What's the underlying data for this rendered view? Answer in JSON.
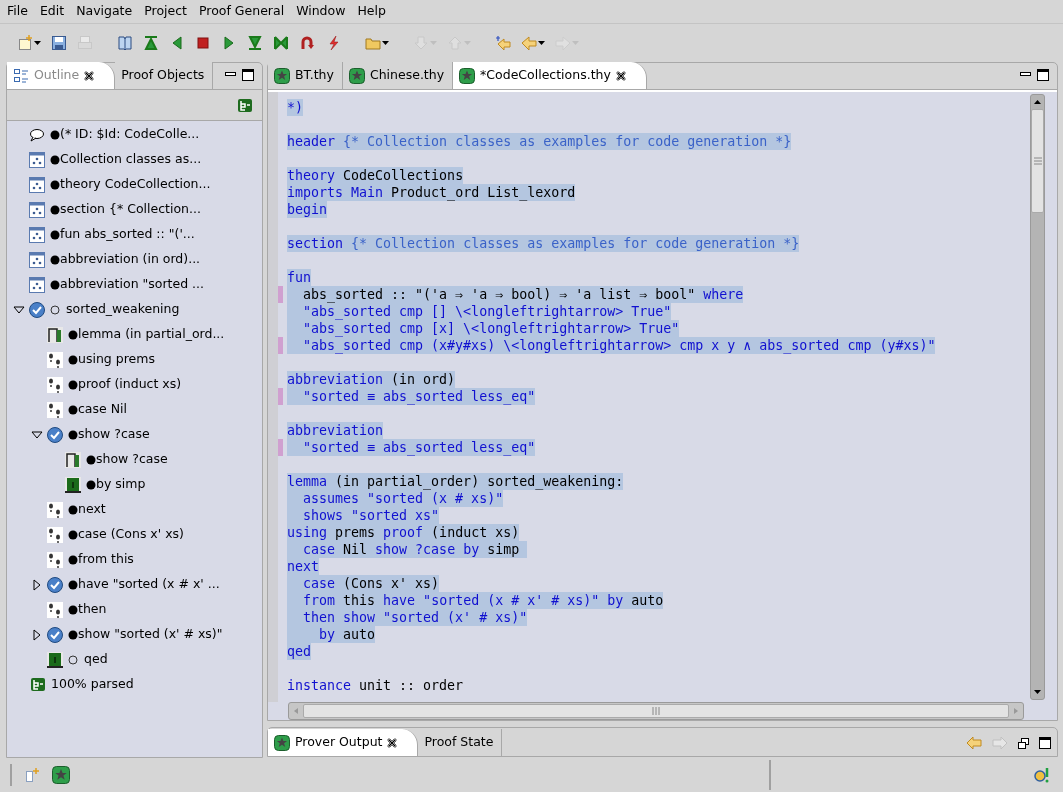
{
  "menu": [
    {
      "label": "File"
    },
    {
      "label": "Edit"
    },
    {
      "label": "Navigate"
    },
    {
      "label": "Project"
    },
    {
      "label": "Proof General"
    },
    {
      "label": "Window"
    },
    {
      "label": "Help"
    }
  ],
  "toolbar": [
    {
      "kind": "new",
      "disabled": false,
      "dropdown": true
    },
    {
      "kind": "save",
      "disabled": false
    },
    {
      "kind": "print",
      "disabled": true
    },
    {
      "kind": "book",
      "disabled": false
    },
    {
      "kind": "first",
      "disabled": false
    },
    {
      "kind": "back",
      "disabled": false
    },
    {
      "kind": "stop",
      "disabled": false
    },
    {
      "kind": "play",
      "disabled": false
    },
    {
      "kind": "last",
      "disabled": false
    },
    {
      "kind": "bowtie",
      "disabled": false
    },
    {
      "kind": "undo",
      "disabled": false
    },
    {
      "kind": "bolt",
      "disabled": false
    },
    {
      "kind": "folder",
      "disabled": false,
      "dropdown": true
    },
    {
      "kind": "down",
      "disabled": true,
      "dropdown": true
    },
    {
      "kind": "up",
      "disabled": true,
      "dropdown": true
    },
    {
      "kind": "starback",
      "disabled": false
    },
    {
      "kind": "left",
      "disabled": false,
      "dropdown": true
    },
    {
      "kind": "right",
      "disabled": true,
      "dropdown": true
    }
  ],
  "left_panel": {
    "tabs": [
      {
        "label": "Outline",
        "selected": true
      },
      {
        "label": "Proof Objects",
        "selected": false
      }
    ],
    "outline": [
      {
        "kind": "comment",
        "complete": true,
        "label": "(* ID: $Id: CodeColle..."
      },
      {
        "kind": "section",
        "complete": true,
        "label": "Collection classes as..."
      },
      {
        "kind": "section",
        "complete": true,
        "label": "theory CodeCollection..."
      },
      {
        "kind": "section",
        "complete": true,
        "label": "section {* Collection..."
      },
      {
        "kind": "section",
        "complete": true,
        "label": "fun abs_sorted :: \"('..."
      },
      {
        "kind": "section",
        "complete": true,
        "label": "abbreviation (in ord)..."
      },
      {
        "kind": "section",
        "complete": true,
        "label": "abbreviation \"sorted ..."
      },
      {
        "kind": "proof",
        "complete": false,
        "label": "sorted_weakening",
        "expanded": true,
        "children": [
          {
            "kind": "goal",
            "complete": true,
            "label": "lemma (in partial_ord..."
          },
          {
            "kind": "step",
            "complete": true,
            "label": "using prems"
          },
          {
            "kind": "step",
            "complete": true,
            "label": "proof (induct xs)"
          },
          {
            "kind": "step",
            "complete": true,
            "label": "case Nil"
          },
          {
            "kind": "proof",
            "complete": true,
            "label": "show ?case",
            "expanded": true,
            "children": [
              {
                "kind": "goal",
                "complete": true,
                "label": "show ?case"
              },
              {
                "kind": "done",
                "complete": true,
                "label": "by simp"
              }
            ]
          },
          {
            "kind": "step",
            "complete": true,
            "label": "next"
          },
          {
            "kind": "step",
            "complete": true,
            "label": "case (Cons x' xs)"
          },
          {
            "kind": "step",
            "complete": true,
            "label": "from this"
          },
          {
            "kind": "proof",
            "complete": true,
            "label": "have \"sorted (x # x' ...",
            "expanded": false
          },
          {
            "kind": "step",
            "complete": true,
            "label": "then"
          },
          {
            "kind": "proof",
            "complete": true,
            "label": "show \"sorted (x' # xs)\"",
            "expanded": false
          },
          {
            "kind": "done",
            "complete": false,
            "label": "qed"
          }
        ]
      }
    ],
    "status": "100% parsed"
  },
  "editor": {
    "tabs": [
      {
        "label": "BT.thy",
        "selected": false
      },
      {
        "label": "Chinese.thy",
        "selected": false
      },
      {
        "label": "*CodeCollections.thy",
        "selected": true
      }
    ],
    "lines": [
      {
        "kind": "code",
        "marked": false,
        "processed": true,
        "segments": [
          {
            "kind": "keyword",
            "text": "*)"
          }
        ]
      },
      {
        "kind": "blank"
      },
      {
        "kind": "code",
        "marked": false,
        "processed": true,
        "segments": [
          {
            "kind": "keyword",
            "text": "header"
          },
          {
            "kind": "comment",
            "text": " {* Collection classes as examples for code generation *}"
          }
        ]
      },
      {
        "kind": "blank"
      },
      {
        "kind": "code",
        "marked": false,
        "processed": true,
        "segments": [
          {
            "kind": "keyword",
            "text": "theory"
          },
          {
            "kind": "plain",
            "text": " CodeCollections"
          }
        ]
      },
      {
        "kind": "code",
        "marked": false,
        "processed": true,
        "segments": [
          {
            "kind": "keyword",
            "text": "imports Main"
          },
          {
            "kind": "plain",
            "text": " Product_ord List_lexord"
          }
        ]
      },
      {
        "kind": "code",
        "marked": false,
        "processed": true,
        "segments": [
          {
            "kind": "keyword",
            "text": "begin"
          }
        ]
      },
      {
        "kind": "blank"
      },
      {
        "kind": "code",
        "marked": false,
        "processed": true,
        "segments": [
          {
            "kind": "keyword",
            "text": "section"
          },
          {
            "kind": "comment",
            "text": " {* Collection classes as examples for code generation *}"
          }
        ]
      },
      {
        "kind": "blank"
      },
      {
        "kind": "code",
        "marked": false,
        "processed": true,
        "segments": [
          {
            "kind": "keyword",
            "text": "fun"
          }
        ]
      },
      {
        "kind": "code",
        "marked": true,
        "processed": true,
        "segments": [
          {
            "kind": "plain",
            "text": "  abs_sorted :: \"('a ⇒ 'a ⇒ bool) ⇒ 'a list ⇒ bool\" "
          },
          {
            "kind": "keyword",
            "text": "where"
          }
        ]
      },
      {
        "kind": "code",
        "marked": false,
        "processed": true,
        "segments": [
          {
            "kind": "keyword",
            "text": "  \"abs_sorted cmp [] \\<longleftrightarrow> True\""
          }
        ]
      },
      {
        "kind": "code",
        "marked": false,
        "processed": true,
        "segments": [
          {
            "kind": "keyword",
            "text": "  \"abs_sorted cmp [x] \\<longleftrightarrow> True\""
          }
        ]
      },
      {
        "kind": "code",
        "marked": true,
        "processed": true,
        "segments": [
          {
            "kind": "keyword",
            "text": "  \"abs_sorted cmp (x#y#xs) \\<longleftrightarrow> cmp x y ∧ abs_sorted cmp (y#xs)\""
          }
        ]
      },
      {
        "kind": "blank"
      },
      {
        "kind": "code",
        "marked": false,
        "processed": true,
        "segments": [
          {
            "kind": "keyword",
            "text": "abbreviation"
          },
          {
            "kind": "plain",
            "text": " (in ord)"
          }
        ]
      },
      {
        "kind": "code",
        "marked": true,
        "processed": true,
        "segments": [
          {
            "kind": "keyword",
            "text": "  \"sorted ≡ abs_sorted less_eq\""
          }
        ]
      },
      {
        "kind": "blank"
      },
      {
        "kind": "code",
        "marked": false,
        "processed": true,
        "segments": [
          {
            "kind": "keyword",
            "text": "abbreviation"
          }
        ]
      },
      {
        "kind": "code",
        "marked": true,
        "processed": true,
        "segments": [
          {
            "kind": "keyword",
            "text": "  \"sorted ≡ abs_sorted less_eq\""
          }
        ]
      },
      {
        "kind": "blank"
      },
      {
        "kind": "code",
        "marked": false,
        "processed": true,
        "segments": [
          {
            "kind": "keyword",
            "text": "lemma"
          },
          {
            "kind": "plain",
            "text": " (in partial_order) sorted_weakening:"
          }
        ]
      },
      {
        "kind": "code",
        "marked": false,
        "processed": true,
        "segments": [
          {
            "kind": "keyword",
            "text": "  assumes \"sorted (x # xs)\""
          }
        ]
      },
      {
        "kind": "code",
        "marked": false,
        "processed": true,
        "segments": [
          {
            "kind": "keyword",
            "text": "  shows \"sorted xs\""
          }
        ]
      },
      {
        "kind": "code",
        "marked": false,
        "processed": true,
        "segments": [
          {
            "kind": "keyword",
            "text": "using"
          },
          {
            "kind": "plain",
            "text": " prems "
          },
          {
            "kind": "keyword",
            "text": "proof"
          },
          {
            "kind": "plain",
            "text": " (induct xs)"
          }
        ]
      },
      {
        "kind": "code",
        "marked": false,
        "processed": true,
        "segments": [
          {
            "kind": "keyword",
            "text": "  case"
          },
          {
            "kind": "plain",
            "text": " Nil "
          },
          {
            "kind": "keyword",
            "text": "show ?case by"
          },
          {
            "kind": "plain",
            "text": " simp "
          }
        ]
      },
      {
        "kind": "code",
        "marked": false,
        "processed": true,
        "segments": [
          {
            "kind": "keyword",
            "text": "next"
          }
        ]
      },
      {
        "kind": "code",
        "marked": false,
        "processed": true,
        "segments": [
          {
            "kind": "keyword",
            "text": "  case"
          },
          {
            "kind": "plain",
            "text": " (Cons x' xs)"
          }
        ]
      },
      {
        "kind": "code",
        "marked": false,
        "processed": true,
        "segments": [
          {
            "kind": "keyword",
            "text": "  from"
          },
          {
            "kind": "plain",
            "text": " this "
          },
          {
            "kind": "keyword",
            "text": "have \"sorted (x # x' # xs)\" by"
          },
          {
            "kind": "plain",
            "text": " auto"
          }
        ]
      },
      {
        "kind": "code",
        "marked": false,
        "processed": true,
        "segments": [
          {
            "kind": "keyword",
            "text": "  then show \"sorted (x' # xs)\""
          }
        ]
      },
      {
        "kind": "code",
        "marked": false,
        "processed": true,
        "segments": [
          {
            "kind": "keyword",
            "text": "    by"
          },
          {
            "kind": "plain",
            "text": " auto"
          }
        ]
      },
      {
        "kind": "code",
        "marked": false,
        "processed": true,
        "segments": [
          {
            "kind": "keyword",
            "text": "qed"
          }
        ]
      },
      {
        "kind": "blank"
      },
      {
        "kind": "code",
        "marked": false,
        "processed": false,
        "segments": [
          {
            "kind": "keyword",
            "text": "instance"
          },
          {
            "kind": "plain",
            "text": " unit :: order"
          }
        ]
      }
    ]
  },
  "bottom_panel": {
    "tabs": [
      {
        "label": "Prover Output",
        "selected": true
      },
      {
        "label": "Proof State",
        "selected": false
      }
    ]
  }
}
